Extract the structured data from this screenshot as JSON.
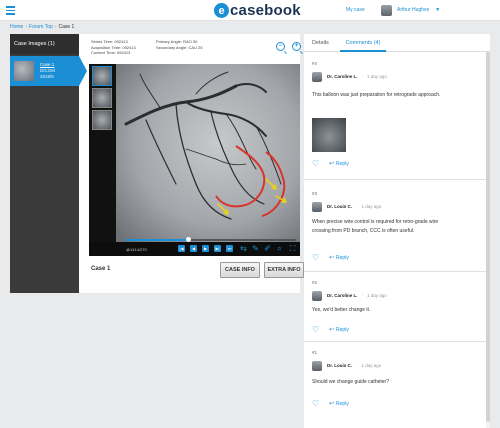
{
  "header": {
    "logo_letter": "e",
    "logo_text": "casebook",
    "my_case": "My case",
    "user_name": "Arthur Hughes",
    "caret": "▼"
  },
  "breadcrumb": [
    "Home",
    "Forum Top",
    "Case 1"
  ],
  "images_panel": {
    "title": "Case Images (1)",
    "items": [
      {
        "title": "Case 1",
        "type": "DICOM",
        "date": "2018/5"
      }
    ]
  },
  "viewer": {
    "series_time": "Series Time: 092413",
    "acquisition_time": "Acquisition Time: 092413",
    "content_time": "Content Time: 092413",
    "primary_angle": "Primary Angle: RAO 30",
    "secondary_angle": "Secondary Angle: CAU 25",
    "zoom_out": "−",
    "zoom_in": "+",
    "frame_counter": "@1414/270",
    "playback_fraction": 0.37,
    "controls": [
      "|◀",
      "◀",
      "▶",
      "▶|",
      "⏭"
    ],
    "tools": [
      "⇆",
      "✎",
      "✐",
      "⌕",
      "⛶"
    ],
    "case_label": "Case 1",
    "case_info_button": "CASE INFO",
    "extra_info_button": "EXTRA INFO"
  },
  "tabs": {
    "details": "Details",
    "comments": "Comments (4)"
  },
  "comments": [
    {
      "num": "#4",
      "author": "Dr. Caroline L.",
      "time": "1 day ago",
      "text": "This balloon was just preparation for retrograde approach.",
      "has_image": true
    },
    {
      "num": "#3",
      "author": "Dr. Louis C.",
      "time": "1 day ago",
      "text": "When precise wire control is required for retro-grade wire crossing from PD branch, CCC is often useful.",
      "has_image": false
    },
    {
      "num": "#2",
      "author": "Dr. Caroline L.",
      "time": "1 day ago",
      "text": "Yes, we'd better change it.",
      "has_image": false
    },
    {
      "num": "#1",
      "author": "Dr. Louis C.",
      "time": "1 day ago",
      "text": "Should we change guide catheter?",
      "has_image": false
    }
  ],
  "reply_label": "Reply",
  "colors": {
    "accent": "#1a8fd6",
    "annotation_red": "#d9342b",
    "annotation_yellow": "#e8d21a"
  }
}
